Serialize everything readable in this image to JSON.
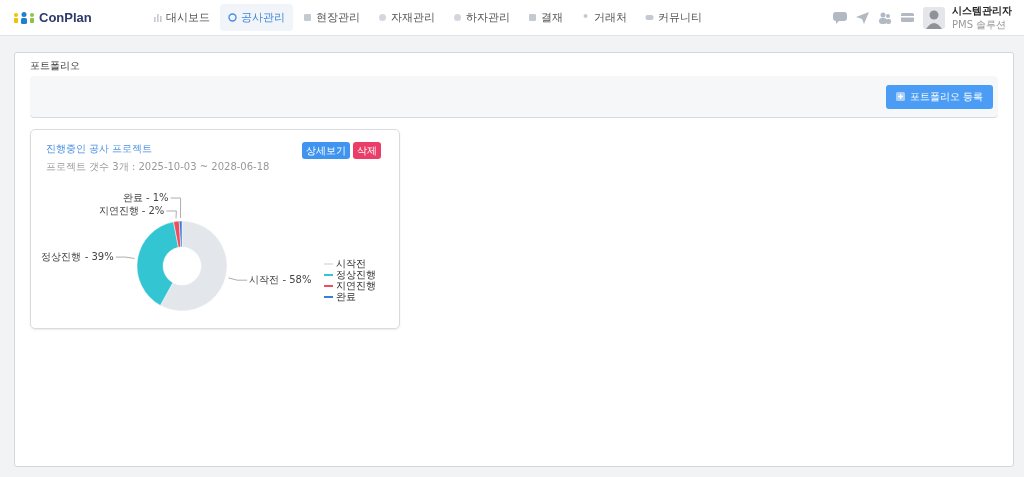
{
  "brand": {
    "name": "ConPlan"
  },
  "nav": [
    {
      "label": "대시보드",
      "selected": false
    },
    {
      "label": "공사관리",
      "selected": true
    },
    {
      "label": "현장관리",
      "selected": false
    },
    {
      "label": "자재관리",
      "selected": false
    },
    {
      "label": "하자관리",
      "selected": false
    },
    {
      "label": "결재",
      "selected": false
    },
    {
      "label": "거래처",
      "selected": false
    },
    {
      "label": "커뮤니티",
      "selected": false
    }
  ],
  "user": {
    "name": "시스템관리자",
    "role": "PMS 솔루션"
  },
  "page": {
    "title": "포트폴리오",
    "register_button": "포트폴리오 등록"
  },
  "cards": [
    {
      "title": "진행중인 공사 프로젝트",
      "subtitle": "프로젝트 갯수 3개 : 2025-10-03 ~ 2028-06-18",
      "detail_button": "상세보기",
      "delete_button": "삭제",
      "chart_data": {
        "type": "donut",
        "categories": [
          "시작전",
          "정상진행",
          "지연진행",
          "완료"
        ],
        "values": [
          58,
          39,
          2,
          1
        ],
        "legend": "right",
        "colors": [
          "#e3e6ea",
          "#33c6d2",
          "#ef4d5a",
          "#3a7fd5"
        ],
        "annotations": [
          "시작전 - 58%",
          "정상진행 - 39%",
          "지연진행 - 2%",
          "완료 - 1%"
        ]
      }
    }
  ]
}
